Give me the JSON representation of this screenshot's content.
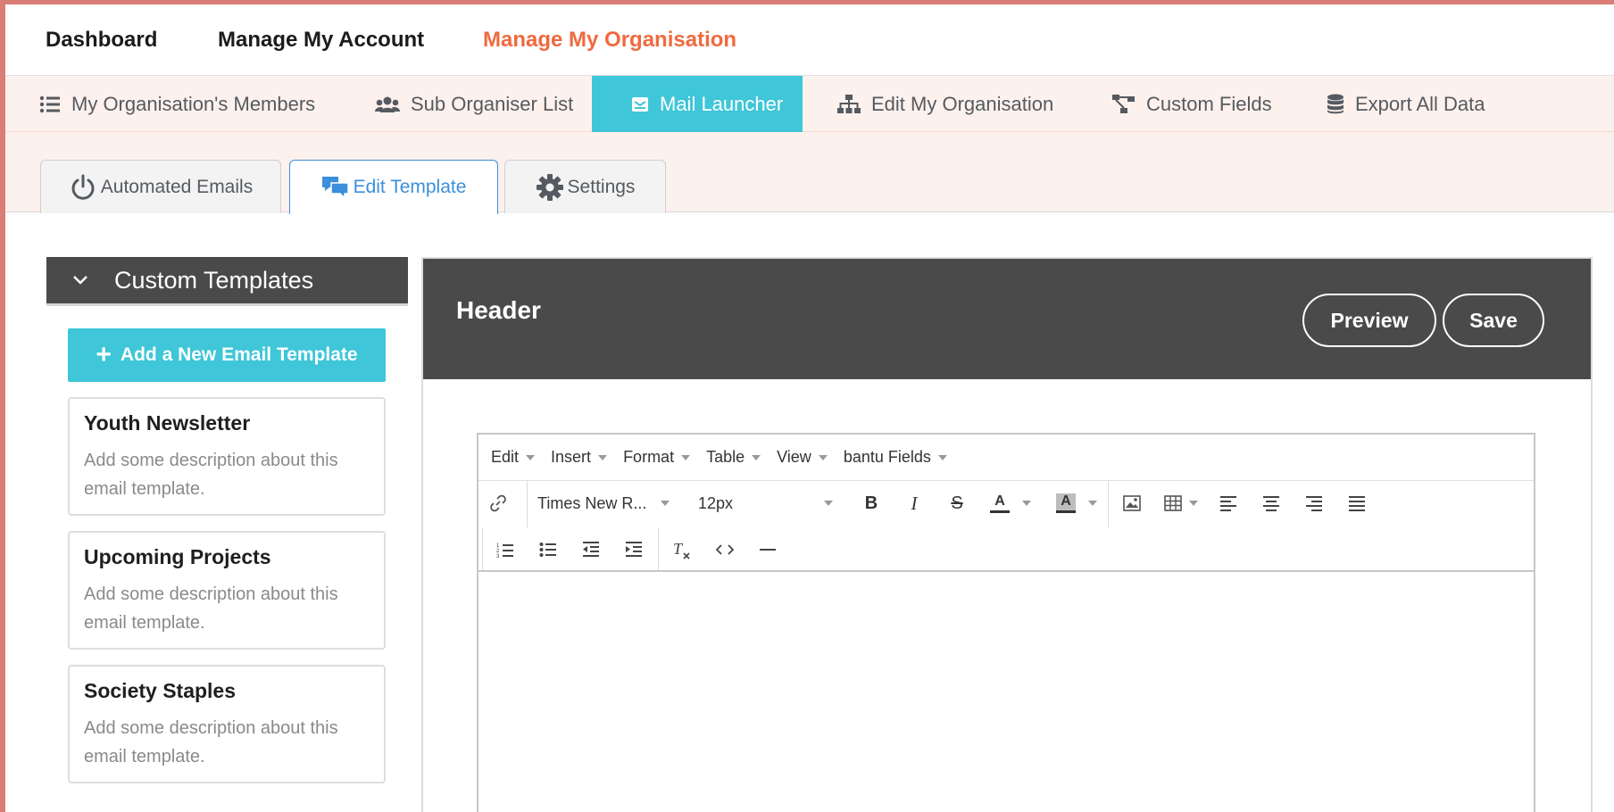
{
  "topnav": {
    "dashboard": "Dashboard",
    "manage_account": "Manage My Account",
    "manage_org": "Manage My Organisation"
  },
  "subnav": {
    "members": "My Organisation's Members",
    "sub_organiser": "Sub Organiser List",
    "mail_launcher": "Mail Launcher",
    "edit_org": "Edit My Organisation",
    "custom_fields": "Custom Fields",
    "export": "Export All Data"
  },
  "tabs": {
    "automated": "Automated Emails",
    "edit_template": "Edit Template",
    "settings": "Settings"
  },
  "sidebar": {
    "title": "Custom Templates",
    "add_button": "Add a New Email Template",
    "templates": [
      {
        "title": "Youth Newsletter",
        "description": "Add some description about this email template."
      },
      {
        "title": "Upcoming Projects",
        "description": "Add some description about this email template."
      },
      {
        "title": "Society Staples",
        "description": "Add some description about this email template."
      }
    ]
  },
  "editor": {
    "header_title": "Header",
    "preview_label": "Preview",
    "save_label": "Save",
    "menu": {
      "edit": "Edit",
      "insert": "Insert",
      "format": "Format",
      "table": "Table",
      "view": "View",
      "fields": "bantu Fields"
    },
    "font_family": "Times New R...",
    "font_size": "12px",
    "bold": "B",
    "italic": "I",
    "strike": "S",
    "text_color": "A",
    "bg_color": "A"
  },
  "colors": {
    "accent_orange": "#ef6a3f",
    "accent_cyan": "#3fc6d8",
    "accent_blue": "#3b8fdb",
    "dark_header": "#4a4a4a"
  }
}
